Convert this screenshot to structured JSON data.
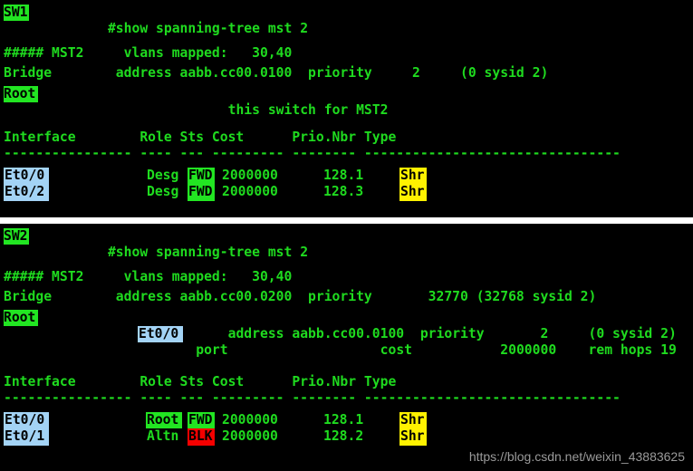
{
  "terminal": {
    "background_color": "#000000",
    "text_color": "#1fdb1f",
    "highlight_green": "#22e522",
    "highlight_blue": "#a3d3f5",
    "highlight_yellow": "#fff200",
    "highlight_red": "#f50000",
    "highlight_text_color": "#000000"
  },
  "panel1": {
    "prompt_host": "SW1",
    "prompt_command": "#show spanning-tree mst 2",
    "blank1": "",
    "instance_line": "##### MST2     vlans mapped:   30,40",
    "bridge_line": "Bridge        address aabb.cc00.0100  priority     2     (0 sysid 2)",
    "root_label": "Root",
    "root_line": "              this switch for MST2",
    "blank2": "",
    "table_header": "Interface        Role Sts Cost      Prio.Nbr Type",
    "table_divider": "---------------- ---- --- --------- -------- --------------------------------",
    "rows": [
      {
        "interface": "Et0/0",
        "role": "Desg",
        "status": "FWD",
        "cost": "2000000",
        "prio_nbr": "128.1",
        "type": "Shr"
      },
      {
        "interface": "Et0/2",
        "role": "Desg",
        "status": "FWD",
        "cost": "2000000",
        "prio_nbr": "128.3",
        "type": "Shr"
      }
    ]
  },
  "panel2": {
    "prompt_host": "SW2",
    "prompt_command": "#show spanning-tree mst 2",
    "blank1": "",
    "instance_line": "##### MST2     vlans mapped:   30,40",
    "bridge_line": "Bridge        address aabb.cc00.0200  priority       32770 (32768 sysid 2)",
    "root_label": "Root",
    "root_line": "              address aabb.cc00.0100  priority       2     (0 sysid 2)",
    "port_line_prefix": "              port    ",
    "port_value": "Et0/0",
    "port_line_suffix": "          cost           2000000    rem hops 19",
    "blank2": "",
    "table_header": "Interface        Role Sts Cost      Prio.Nbr Type",
    "table_divider": "---------------- ---- --- --------- -------- --------------------------------",
    "rows": [
      {
        "interface": "Et0/0",
        "role": "Root",
        "status": "FWD",
        "cost": "2000000",
        "prio_nbr": "128.1",
        "type": "Shr"
      },
      {
        "interface": "Et0/1",
        "role": "Altn",
        "status": "BLK",
        "cost": "2000000",
        "prio_nbr": "128.2",
        "type": "Shr"
      }
    ]
  },
  "watermark": {
    "text": "https://blog.csdn.net/weixin_43883625"
  }
}
